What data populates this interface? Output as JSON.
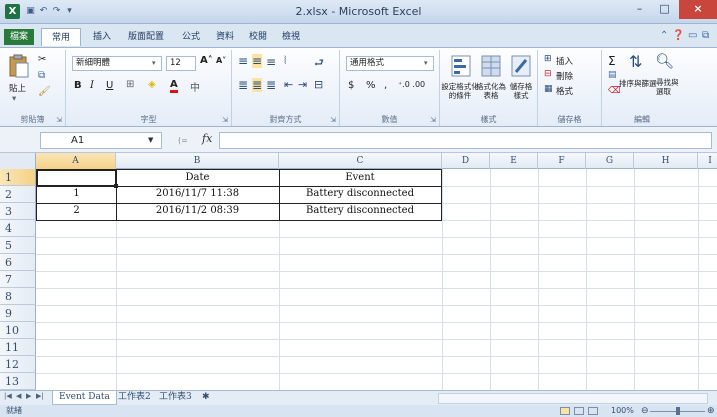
{
  "window": {
    "title": "2.xlsx - Microsoft Excel",
    "logo": "X",
    "min": "–",
    "max": "□",
    "close": "×"
  },
  "ribbon_tabs": [
    "檔案",
    "常用",
    "插入",
    "版面配置",
    "公式",
    "資料",
    "校閱",
    "檢視"
  ],
  "ribbon": {
    "clipboard": {
      "paste": "貼上",
      "label": "剪貼簿"
    },
    "font": {
      "name": "新細明體",
      "size": "12",
      "bold": "B",
      "italic": "I",
      "underline": "U",
      "grow": "A˄",
      "shrink": "A˅",
      "label": "字型"
    },
    "alignment": {
      "label": "對齊方式"
    },
    "number": {
      "format": "通用格式",
      "currency": "$",
      "percent": "%",
      "comma": ",",
      "inc_dec": "⁺.0 .00",
      "label": "數值"
    },
    "styles": {
      "conditional": "設定格式化\n的條件",
      "as_table": "格式化為\n表格",
      "cell_styles": "儲存格\n樣式",
      "label": "樣式"
    },
    "cells": {
      "insert": "插入",
      "delete": "刪除",
      "format": "格式",
      "label": "儲存格"
    },
    "editing": {
      "sum": "Σ",
      "sort": "排序與篩選",
      "find": "尋找與\n選取",
      "label": "編輯"
    }
  },
  "formula_bar": {
    "name_box": "A1",
    "fx": "fx",
    "content": ""
  },
  "grid": {
    "columns": [
      "A",
      "B",
      "C",
      "D",
      "E",
      "F",
      "G",
      "H",
      "I"
    ],
    "rows": [
      "1",
      "2",
      "3",
      "4",
      "5",
      "6",
      "7",
      "8",
      "9",
      "10",
      "11",
      "12",
      "13"
    ],
    "selected_cell": "A1",
    "cells": {
      "B1": "Date",
      "C1": "Event",
      "A2": "1",
      "B2": "2016/11/7 11:38",
      "C2": "Battery disconnected",
      "A3": "2",
      "B3": "2016/11/2 08:39",
      "C3": "Battery disconnected"
    }
  },
  "sheet_tabs": [
    "Event Data",
    "工作表2",
    "工作表3"
  ],
  "status": {
    "mode": "就緒",
    "zoom": "100%"
  },
  "colors": {
    "accent": "#1f7244",
    "close": "#c9463d",
    "header_selected": "#f5d186"
  }
}
